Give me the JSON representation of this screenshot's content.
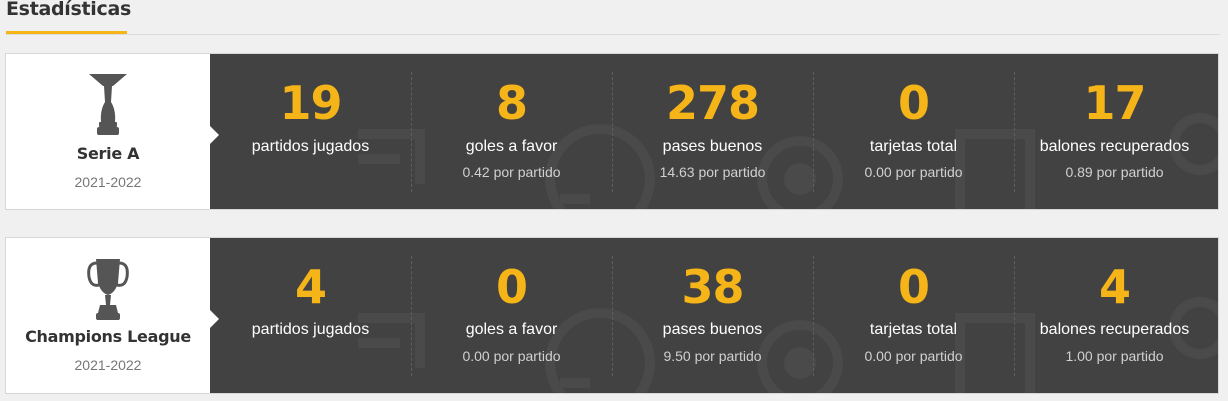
{
  "section": {
    "title": "Estadísticas"
  },
  "colors": {
    "accent": "#f5b417",
    "panel": "#424242",
    "label": "#ffffff",
    "sub": "#d0d0d0"
  },
  "competitions": [
    {
      "name": "Serie A",
      "season": "2021-2022",
      "trophy_icon": "serie-a-trophy-icon",
      "stats": [
        {
          "value": "19",
          "label": "partidos jugados",
          "sub": ""
        },
        {
          "value": "8",
          "label": "goles a favor",
          "sub": "0.42 por partido"
        },
        {
          "value": "278",
          "label": "pases buenos",
          "sub": "14.63 por partido"
        },
        {
          "value": "0",
          "label": "tarjetas total",
          "sub": "0.00 por partido"
        },
        {
          "value": "17",
          "label": "balones recuperados",
          "sub": "0.89 por partido"
        }
      ]
    },
    {
      "name": "Champions League",
      "season": "2021-2022",
      "trophy_icon": "champions-league-trophy-icon",
      "stats": [
        {
          "value": "4",
          "label": "partidos jugados",
          "sub": ""
        },
        {
          "value": "0",
          "label": "goles a favor",
          "sub": "0.00 por partido"
        },
        {
          "value": "38",
          "label": "pases buenos",
          "sub": "9.50 por partido"
        },
        {
          "value": "0",
          "label": "tarjetas total",
          "sub": "0.00 por partido"
        },
        {
          "value": "4",
          "label": "balones recuperados",
          "sub": "1.00 por partido"
        }
      ]
    }
  ]
}
